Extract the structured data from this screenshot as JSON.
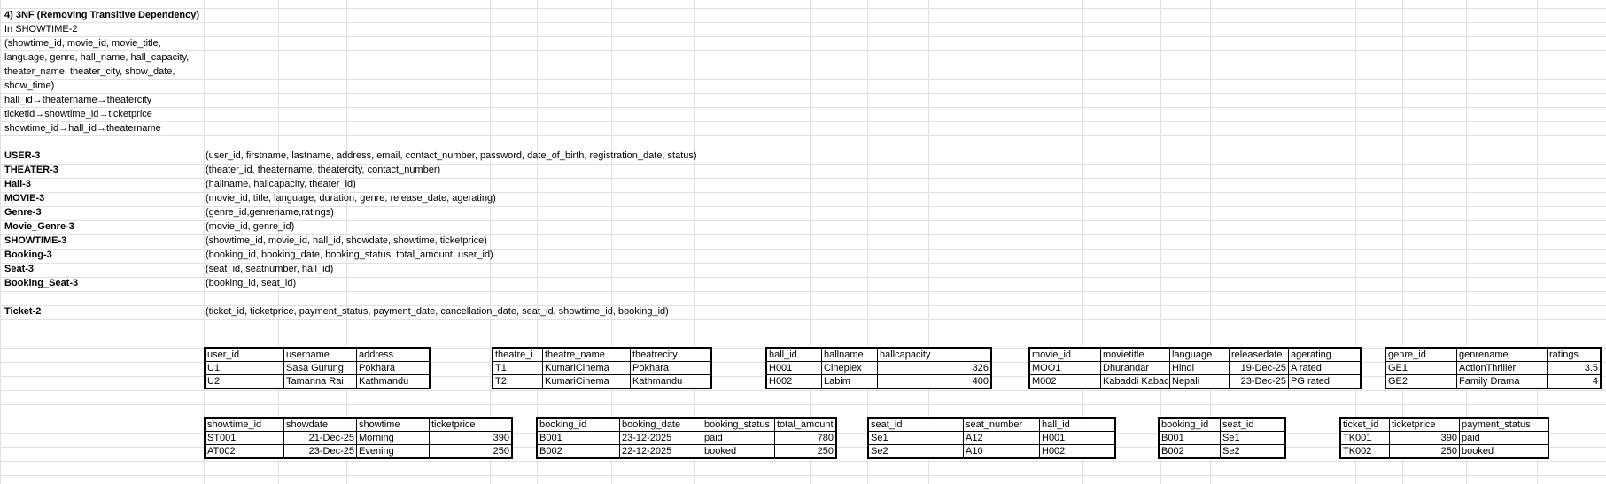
{
  "title": "4) 3NF (Removing Transitive Dependency)",
  "intro": {
    "line1": "In SHOWTIME-2",
    "attr_lines": [
      "(showtime_id, movie_id, movie_title,",
      "language, genre, hall_name, hall_capacity,",
      "theater_name, theater_city, show_date,",
      "show_time)"
    ],
    "dependencies": [
      " hall_id→theatername→theatercity",
      " ticketid→showtime_id→ticketprice",
      " showtime_id→hall_id→theatername"
    ]
  },
  "relations": [
    {
      "name": "USER-3",
      "attrs": "(user_id, firstname, lastname, address, email, contact_number, password, date_of_birth, registration_date, status)"
    },
    {
      "name": "THEATER-3",
      "attrs": "(theater_id, theatername, theatercity, contact_number)"
    },
    {
      "name": "Hall-3",
      "attrs": "(hallname, hallcapacity, theater_id)"
    },
    {
      "name": "MOVIE-3",
      "attrs": "(movie_id, title, language, duration, genre, release_date, agerating)"
    },
    {
      "name": "Genre-3",
      "attrs": "(genre_id,genrename,ratings)"
    },
    {
      "name": "Movie_Genre-3",
      "attrs": "(movie_id, genre_id)"
    },
    {
      "name": "SHOWTIME-3",
      "attrs": "(showtime_id, movie_id, hall_id, showdate, showtime, ticketprice)"
    },
    {
      "name": "Booking-3",
      "attrs": "(booking_id, booking_date, booking_status, total_amount, user_id)"
    },
    {
      "name": "Seat-3",
      "attrs": "(seat_id, seatnumber, hall_id)"
    },
    {
      "name": "Booking_Seat-3",
      "attrs": "(booking_id, seat_id)"
    }
  ],
  "ticket": {
    "name": "Ticket-2",
    "attrs": "(ticket_id, ticketprice, payment_status, payment_date, cancellation_date, seat_id, showtime_id, booking_id)"
  },
  "tables_row1": [
    {
      "headers": [
        "user_id",
        "username",
        "address"
      ],
      "rows": [
        [
          "U1",
          "Sasa Gurung",
          "Pokhara"
        ],
        [
          "U2",
          "Tamanna Rai",
          "Kathmandu"
        ]
      ]
    },
    {
      "headers": [
        "theatre_i",
        "theatre_name",
        "theatrecity"
      ],
      "rows": [
        [
          "T1",
          "KumariCinema",
          "Pokhara"
        ],
        [
          "T2",
          "KumariCinema",
          "Kathmandu"
        ]
      ]
    },
    {
      "headers": [
        "hall_id",
        "hallname",
        "hallcapacity"
      ],
      "rows": [
        [
          "H001",
          "Cineplex",
          "326"
        ],
        [
          "H002",
          "Labim",
          "400"
        ]
      ]
    },
    {
      "headers": [
        "movie_id",
        "movietitle",
        "language",
        "releasedate",
        "agerating"
      ],
      "rows": [
        [
          "MOO1",
          "Dhurandar",
          "Hindi",
          "19-Dec-25",
          "A rated"
        ],
        [
          "M002",
          "Kabaddi Kabac",
          "Nepali",
          "23-Dec-25",
          "PG rated"
        ]
      ]
    },
    {
      "headers": [
        "genre_id",
        "genrename",
        "ratings"
      ],
      "rows": [
        [
          "GE1",
          "ActionThriller",
          "3.5"
        ],
        [
          "GE2",
          "Family Drama",
          "4"
        ]
      ]
    }
  ],
  "tables_row2": [
    {
      "headers": [
        "showtime_id",
        "showdate",
        "showtime",
        "ticketprice"
      ],
      "rows": [
        [
          "ST001",
          "21-Dec-25",
          "Morning",
          "390"
        ],
        [
          "AT002",
          "23-Dec-25",
          "Evening",
          "250"
        ]
      ]
    },
    {
      "headers": [
        "booking_id",
        "booking_date",
        "booking_status",
        "total_amount"
      ],
      "rows": [
        [
          "B001",
          "23-12-2025",
          "paid",
          "780"
        ],
        [
          "B002",
          "22-12-2025",
          "booked",
          "250"
        ]
      ]
    },
    {
      "headers": [
        "seat_id",
        "seat_number",
        "hall_id"
      ],
      "rows": [
        [
          "Se1",
          "A12",
          "H001"
        ],
        [
          "Se2",
          "A10",
          "H002"
        ]
      ]
    },
    {
      "headers": [
        "booking_id",
        "seat_id"
      ],
      "rows": [
        [
          "B001",
          "Se1"
        ],
        [
          "B002",
          "Se2"
        ]
      ]
    },
    {
      "headers": [
        "ticket_id",
        "ticketprice",
        "payment_status"
      ],
      "rows": [
        [
          "TK001",
          "390",
          "paid"
        ],
        [
          "TK002",
          "250",
          "booked"
        ]
      ]
    }
  ]
}
